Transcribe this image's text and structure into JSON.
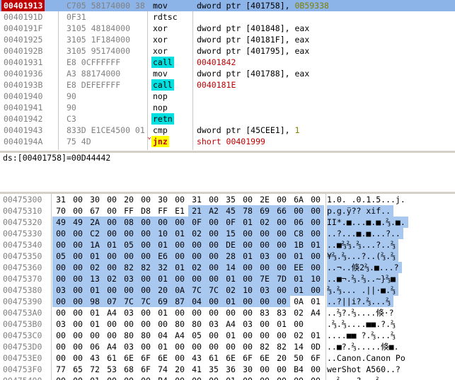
{
  "cpu": {
    "rows": [
      {
        "addr": "00401913",
        "hex": "C705 58174000 38",
        "mn": "mov",
        "op": "dword ptr [401758], ",
        "num": "0B59338",
        "sel": true
      },
      {
        "addr": "0040191D",
        "hex": "0F31",
        "mn": "rdtsc",
        "op": ""
      },
      {
        "addr": "0040191F",
        "hex": "3105 48184000",
        "mn": "xor",
        "op": "dword ptr [401848], eax"
      },
      {
        "addr": "00401925",
        "hex": "3105 1F184000",
        "mn": "xor",
        "op": "dword ptr [40181F], eax"
      },
      {
        "addr": "0040192B",
        "hex": "3105 95174000",
        "mn": "xor",
        "op": "dword ptr [401795], eax"
      },
      {
        "addr": "00401931",
        "hex": "E8 0CFFFFFF",
        "mn": "call",
        "op": "00401842",
        "kind": "call"
      },
      {
        "addr": "00401936",
        "hex": "A3 88174000",
        "mn": "mov",
        "op": "dword ptr [401788], eax"
      },
      {
        "addr": "0040193B",
        "hex": "E8 DEFEFFFF",
        "mn": "call",
        "op": "0040181E",
        "kind": "call"
      },
      {
        "addr": "00401940",
        "hex": "90",
        "mn": "nop",
        "op": ""
      },
      {
        "addr": "00401941",
        "hex": "90",
        "mn": "nop",
        "op": ""
      },
      {
        "addr": "00401942",
        "hex": "C3",
        "mn": "retn",
        "op": "",
        "kind": "ret"
      },
      {
        "addr": "00401943",
        "hex": "833D E1CE4500 01",
        "mn": "cmp",
        "op": "dword ptr [45CEE1], ",
        "num": "1"
      },
      {
        "addr": "0040194A",
        "hex": "75 4D",
        "mn": "jnz",
        "op": "short 00401999",
        "kind": "jcc"
      }
    ]
  },
  "info": {
    "line": "ds:[00401758]=00D44442"
  },
  "dump": {
    "rows": [
      {
        "addr": "00475300",
        "bytes": [
          "31",
          "00",
          "30",
          "00",
          "20",
          "00",
          "30",
          "00",
          "31",
          "00",
          "35",
          "00",
          "2E",
          "00",
          "6A",
          "00"
        ],
        "ascii": "1.0. .0.1.5...j.",
        "hl": []
      },
      {
        "addr": "00475310",
        "bytes": [
          "70",
          "00",
          "67",
          "00",
          "FF",
          "D8",
          "FF",
          "E1",
          "21",
          "A2",
          "45",
          "78",
          "69",
          "66",
          "00",
          "00"
        ],
        "ascii": "p.g.ÿ?? xif..",
        "hl": [
          8,
          9,
          10,
          11,
          12,
          13,
          14,
          15
        ]
      },
      {
        "addr": "00475320",
        "bytes": [
          "49",
          "49",
          "2A",
          "00",
          "08",
          "00",
          "00",
          "00",
          "0F",
          "00",
          "0F",
          "01",
          "02",
          "00",
          "06",
          "00"
        ],
        "ascii": "II*.■...■.■.⅔.■.",
        "hl": [
          0,
          1,
          2,
          3,
          4,
          5,
          6,
          7,
          8,
          9,
          10,
          11,
          12,
          13,
          14,
          15
        ]
      },
      {
        "addr": "00475330",
        "bytes": [
          "00",
          "00",
          "C2",
          "00",
          "00",
          "00",
          "10",
          "01",
          "02",
          "00",
          "15",
          "00",
          "00",
          "00",
          "C8",
          "00"
        ],
        "ascii": "..?...■.■...?..",
        "hl": [
          0,
          1,
          2,
          3,
          4,
          5,
          6,
          7,
          8,
          9,
          10,
          11,
          12,
          13,
          14,
          15
        ]
      },
      {
        "addr": "00475340",
        "bytes": [
          "00",
          "00",
          "1A",
          "01",
          "05",
          "00",
          "01",
          "00",
          "00",
          "00",
          "DE",
          "00",
          "00",
          "00",
          "1B",
          "01"
        ],
        "ascii": "..■⅔⅔.⅔...?..⅔",
        "hl": [
          0,
          1,
          2,
          3,
          4,
          5,
          6,
          7,
          8,
          9,
          10,
          11,
          12,
          13,
          14,
          15
        ]
      },
      {
        "addr": "00475350",
        "bytes": [
          "05",
          "00",
          "01",
          "00",
          "00",
          "00",
          "E6",
          "00",
          "00",
          "00",
          "28",
          "01",
          "03",
          "00",
          "01",
          "00"
        ],
        "ascii": "¥⅔.⅔...?..(⅔.⅔",
        "hl": [
          0,
          1,
          2,
          3,
          4,
          5,
          6,
          7,
          8,
          9,
          10,
          11,
          12,
          13,
          14,
          15
        ]
      },
      {
        "addr": "00475360",
        "bytes": [
          "00",
          "00",
          "02",
          "00",
          "82",
          "82",
          "32",
          "01",
          "02",
          "00",
          "14",
          "00",
          "00",
          "00",
          "EE",
          "00"
        ],
        "ascii": "..¬..倏2⅔.■...?",
        "hl": [
          0,
          1,
          2,
          3,
          4,
          5,
          6,
          7,
          8,
          9,
          10,
          11,
          12,
          13,
          14,
          15
        ]
      },
      {
        "addr": "00475370",
        "bytes": [
          "00",
          "00",
          "13",
          "02",
          "03",
          "00",
          "01",
          "00",
          "00",
          "00",
          "01",
          "00",
          "7E",
          "7D",
          "01",
          "10"
        ],
        "ascii": "..■¬.⅔.⅔..~}⅔■",
        "hl": [
          0,
          1,
          2,
          3,
          4,
          5,
          6,
          7,
          8,
          9,
          10,
          11,
          12,
          13,
          14,
          15
        ]
      },
      {
        "addr": "00475380",
        "bytes": [
          "03",
          "00",
          "01",
          "00",
          "00",
          "00",
          "20",
          "0A",
          "7C",
          "7C",
          "02",
          "10",
          "03",
          "00",
          "01",
          "00"
        ],
        "ascii": "⅔.⅔... .||·■.⅔",
        "hl": [
          0,
          1,
          2,
          3,
          4,
          5,
          6,
          7,
          8,
          9,
          10,
          11,
          12,
          13,
          14,
          15
        ]
      },
      {
        "addr": "00475390",
        "bytes": [
          "00",
          "00",
          "98",
          "07",
          "7C",
          "7C",
          "69",
          "87",
          "04",
          "00",
          "01",
          "00",
          "00",
          "00",
          "0A",
          "01"
        ],
        "ascii": "..?||i?.⅔...⅔",
        "hl": [
          0,
          1,
          2,
          3,
          4,
          5,
          6,
          7,
          8,
          9,
          10,
          11,
          12,
          13
        ]
      },
      {
        "addr": "004753A0",
        "bytes": [
          "00",
          "00",
          "01",
          "A4",
          "03",
          "00",
          "01",
          "00",
          "00",
          "00",
          "00",
          "00",
          "83",
          "83",
          "02",
          "A4"
        ],
        "ascii": "..⅔?.⅔....倏·?",
        "hl": []
      },
      {
        "addr": "004753B0",
        "bytes": [
          "03",
          "00",
          "01",
          "00",
          "00",
          "00",
          "00",
          "80",
          "80",
          "03",
          "A4",
          "03",
          "00",
          "01",
          "00"
        ],
        "ascii": ".⅔.⅔....■■.?.⅔",
        "hl": []
      },
      {
        "addr": "004753C0",
        "bytes": [
          "00",
          "00",
          "00",
          "00",
          "80",
          "80",
          "04",
          "A4",
          "05",
          "00",
          "01",
          "00",
          "00",
          "00",
          "02",
          "01"
        ],
        "ascii": "....■■ ?.⅔...⅔",
        "hl": []
      },
      {
        "addr": "004753D0",
        "bytes": [
          "00",
          "00",
          "06",
          "A4",
          "03",
          "00",
          "01",
          "00",
          "00",
          "00",
          "00",
          "00",
          "82",
          "82",
          "14",
          "0D"
        ],
        "ascii": "..■?.⅔.....倏■.",
        "hl": []
      },
      {
        "addr": "004753E0",
        "bytes": [
          "00",
          "00",
          "43",
          "61",
          "6E",
          "6F",
          "6E",
          "00",
          "43",
          "61",
          "6E",
          "6F",
          "6E",
          "20",
          "50",
          "6F"
        ],
        "ascii": "..Canon.Canon Po",
        "hl": []
      },
      {
        "addr": "004753F0",
        "bytes": [
          "77",
          "65",
          "72",
          "53",
          "68",
          "6F",
          "74",
          "20",
          "41",
          "35",
          "36",
          "30",
          "00",
          "00",
          "B4",
          "00"
        ],
        "ascii": "werShot A560..?",
        "hl": []
      },
      {
        "addr": "00475400",
        "bytes": [
          "00",
          "00",
          "01",
          "00",
          "00",
          "00",
          "B4",
          "00",
          "00",
          "00",
          "01",
          "00",
          "00",
          "00",
          "00",
          "00"
        ],
        "ascii": "..⅔...?...⅔....",
        "hl": []
      }
    ]
  }
}
